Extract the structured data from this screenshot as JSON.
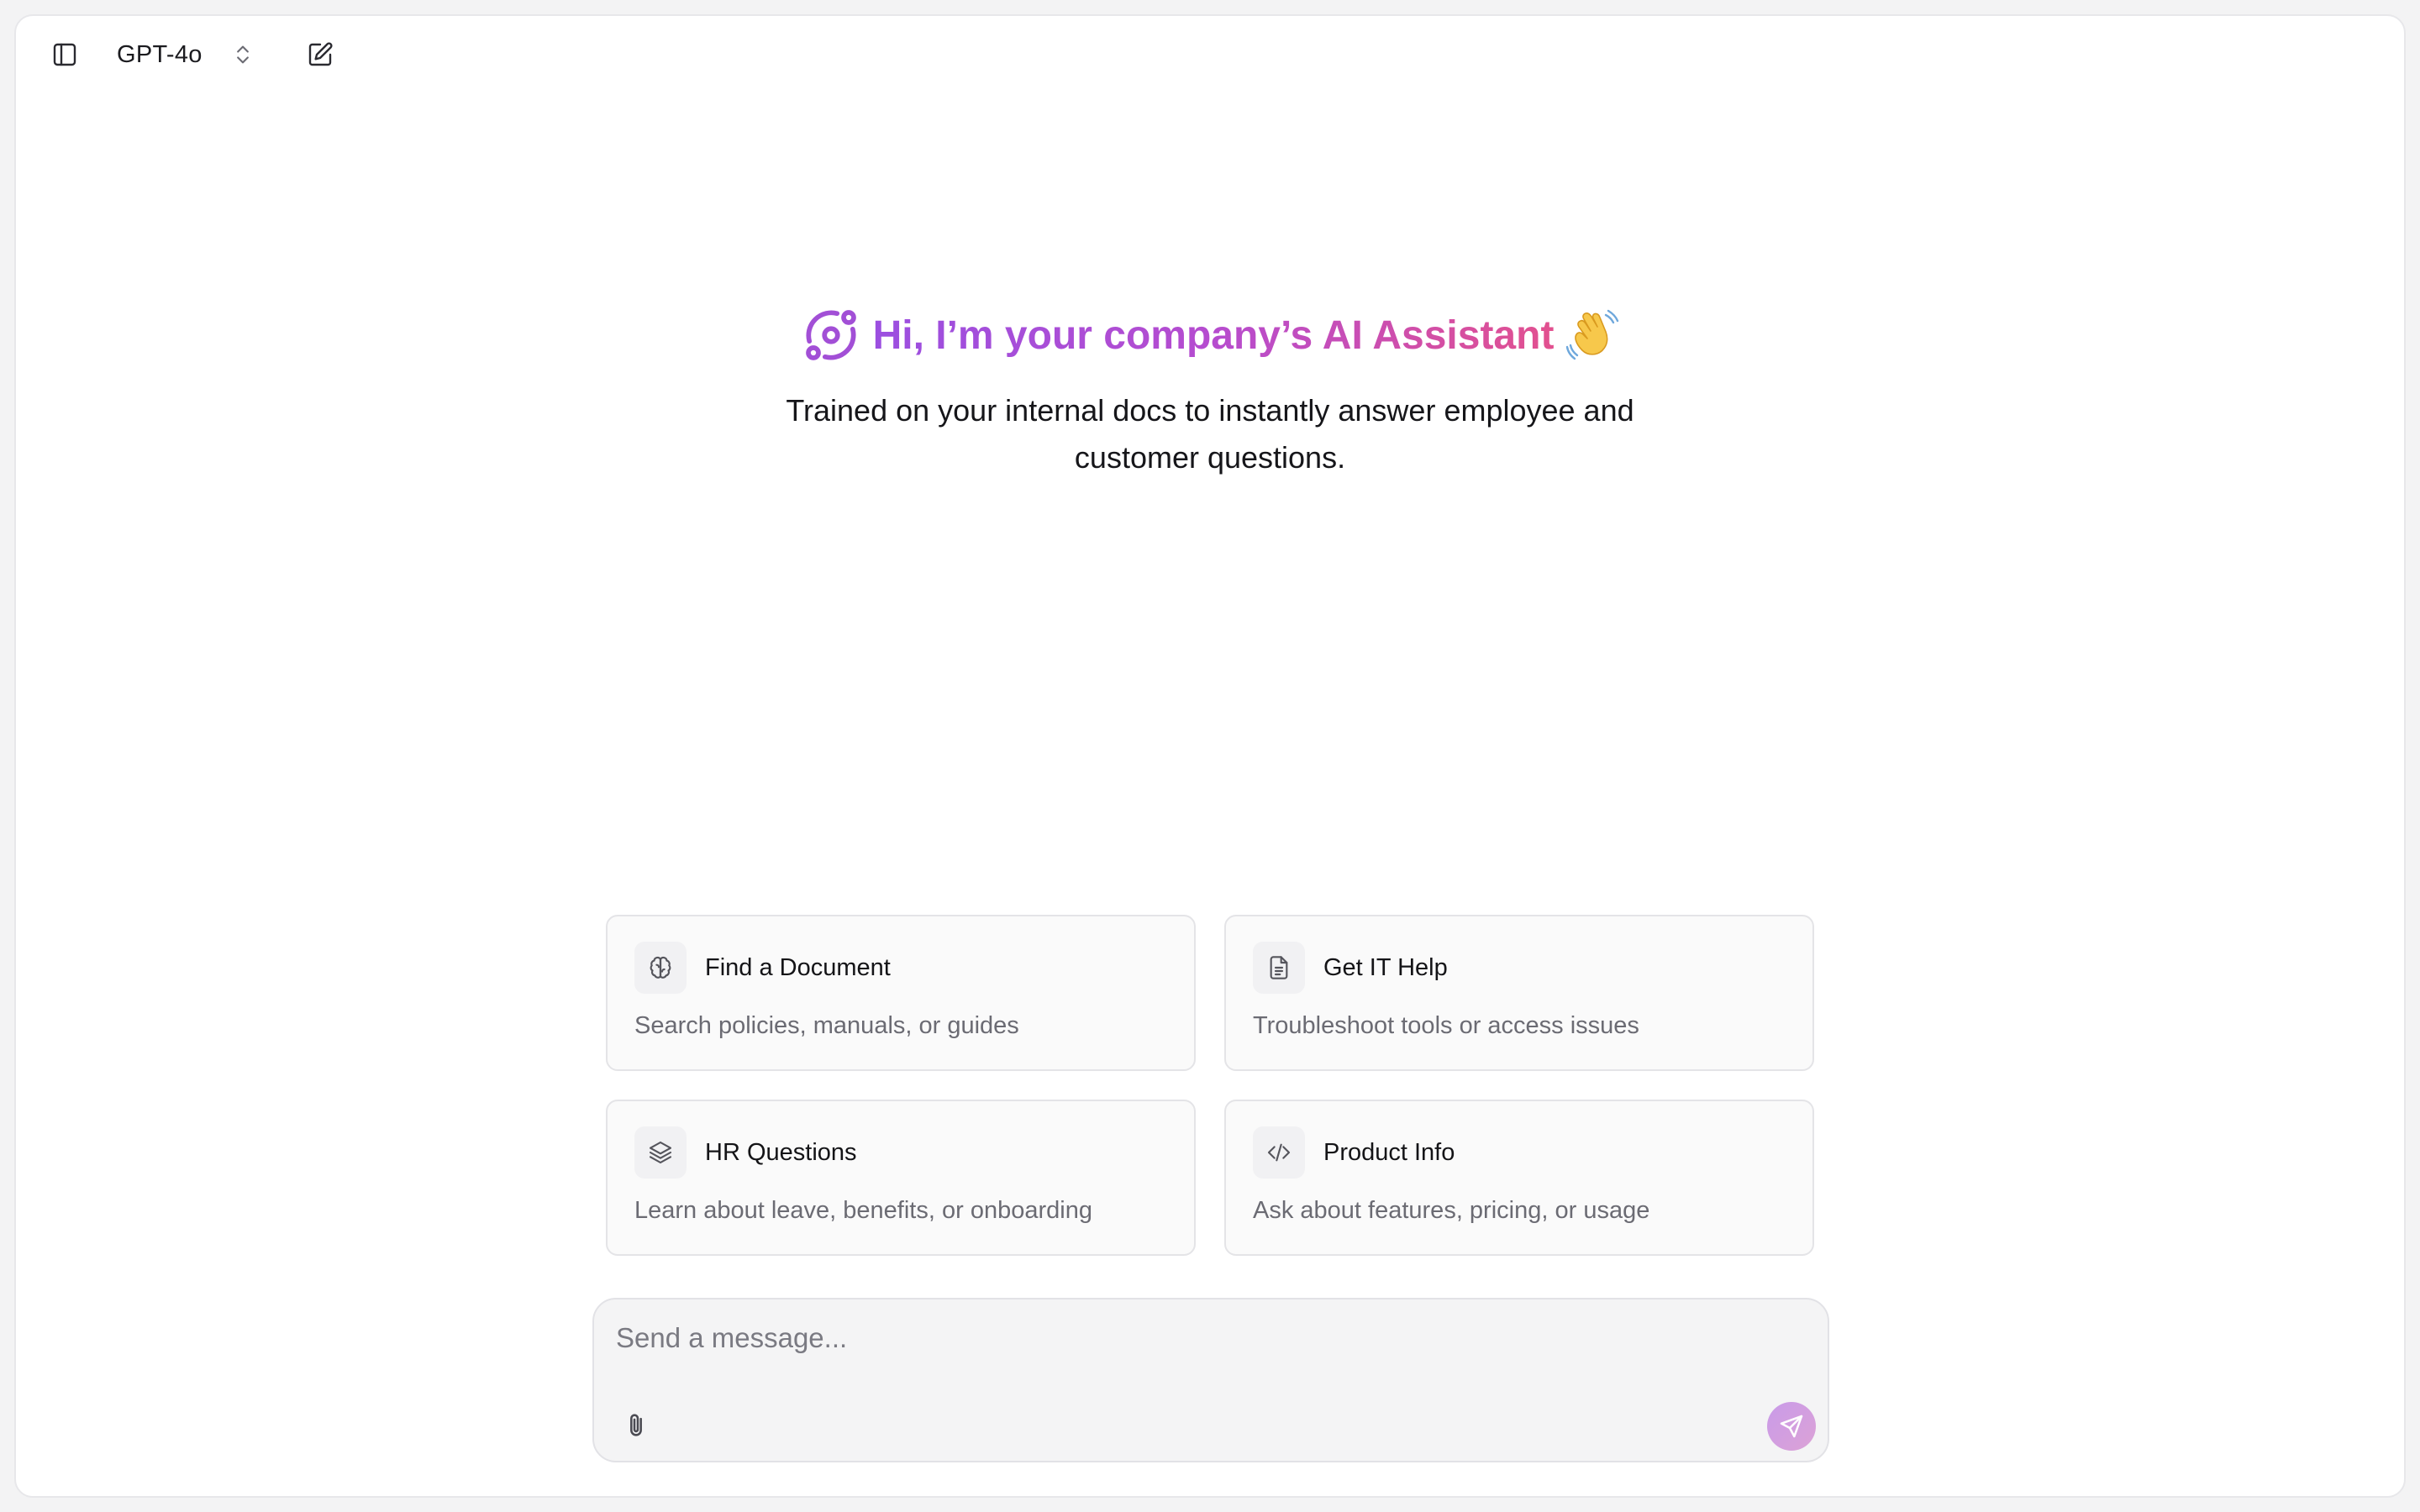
{
  "header": {
    "sidebar_icon": "sidebar-toggle-icon",
    "model": "GPT-4o",
    "model_chevron_icon": "chevrons-up-down-icon",
    "new_chat_icon": "edit-icon"
  },
  "hero": {
    "logo_icon": "orbit-logo-icon",
    "title": "Hi, I’m your company’s AI Assistant",
    "wave_emoji": "waving-hand-icon",
    "subtitle": "Trained on your internal docs to instantly answer employee and customer questions."
  },
  "suggestions": [
    {
      "icon": "brain-icon",
      "title": "Find a Document",
      "description": "Search policies, manuals, or guides"
    },
    {
      "icon": "file-text-icon",
      "title": "Get IT Help",
      "description": "Troubleshoot tools or access issues"
    },
    {
      "icon": "layers-icon",
      "title": "HR Questions",
      "description": "Learn about leave, benefits, or onboarding"
    },
    {
      "icon": "code-icon",
      "title": "Product Info",
      "description": "Ask about features, pricing, or usage"
    }
  ],
  "composer": {
    "placeholder": "Send a message...",
    "value": "",
    "attach_icon": "paperclip-icon",
    "send_icon": "send-icon"
  },
  "colors": {
    "title_gradient_start": "#9b4fe0",
    "title_gradient_end": "#e2508f",
    "send_button": "#d3a0e0",
    "card_background": "#fafafa",
    "page_background": "#ffffff"
  }
}
